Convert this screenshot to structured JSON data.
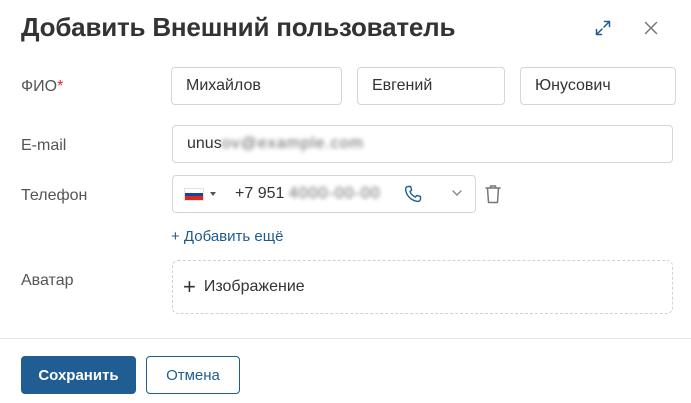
{
  "dialog": {
    "title": "Добавить Внешний пользователь",
    "expand_icon": "expand-icon",
    "close_icon": "close-icon"
  },
  "form": {
    "fio": {
      "label": "ФИО",
      "required_mark": "*",
      "last_name": "Михайлов",
      "first_name": "Евгений",
      "middle_name": "Юнусович"
    },
    "email": {
      "label": "E-mail",
      "value_visible": "unus",
      "value_obscured": "ov@example.com"
    },
    "phone": {
      "label": "Телефон",
      "country_flag": "russia-flag-icon",
      "value_visible": "+7 951",
      "value_obscured": "4000-00-00",
      "call_icon": "phone-icon",
      "dropdown_icon": "chevron-down-icon",
      "delete_icon": "trash-icon",
      "add_more": "+ Добавить ещё"
    },
    "avatar": {
      "label": "Аватар",
      "upload_plus": "+",
      "upload_label": "Изображение"
    }
  },
  "footer": {
    "save_label": "Сохранить",
    "cancel_label": "Отмена"
  },
  "colors": {
    "primary": "#1f5d92",
    "link": "#1d5b8e",
    "required": "#e0242b",
    "border": "#d3d6da"
  }
}
